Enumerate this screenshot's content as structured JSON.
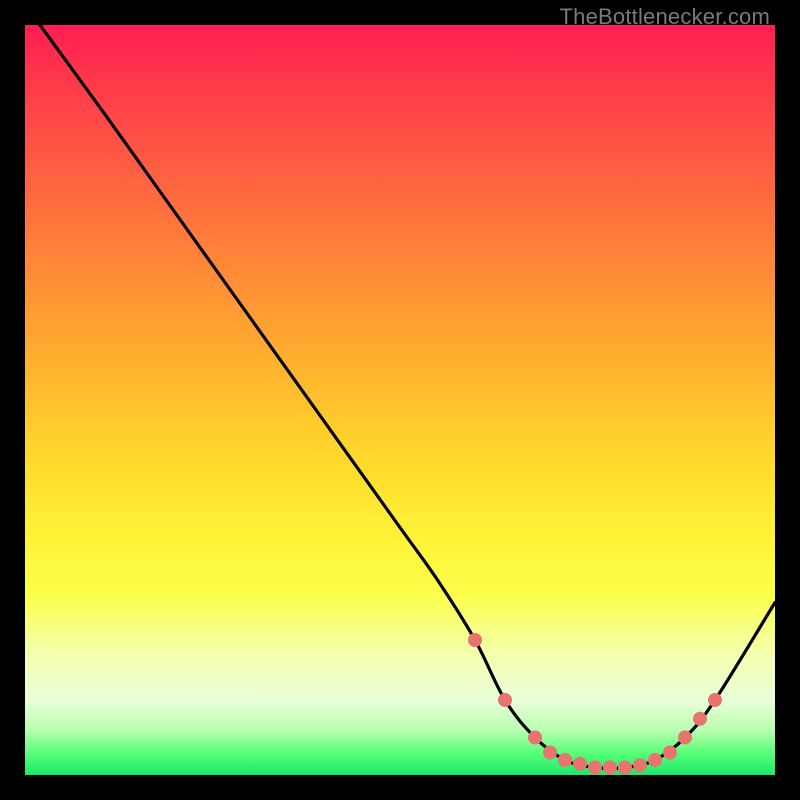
{
  "watermark": "TheBottlenecker.com",
  "chart_data": {
    "type": "line",
    "title": "",
    "xlabel": "",
    "ylabel": "",
    "xlim": [
      0,
      100
    ],
    "ylim": [
      0,
      100
    ],
    "x": [
      2,
      10,
      20,
      30,
      40,
      50,
      55,
      60,
      64,
      68,
      72,
      76,
      80,
      84,
      88,
      92,
      100
    ],
    "values": [
      100,
      89,
      75,
      61,
      47,
      33,
      26,
      18,
      10,
      5,
      2,
      1,
      1,
      2,
      5,
      10,
      23
    ],
    "markers": {
      "x": [
        60,
        64,
        68,
        70,
        72,
        74,
        76,
        78,
        80,
        82,
        84,
        86,
        88,
        90,
        92
      ],
      "values": [
        18,
        10,
        5,
        3,
        2,
        1.5,
        1,
        1,
        1,
        1.3,
        2,
        3,
        5,
        7.5,
        10
      ]
    },
    "gradient_stops": [
      {
        "pos": 0.0,
        "color": "#ff1e52"
      },
      {
        "pos": 0.5,
        "color": "#ffd92c"
      },
      {
        "pos": 0.8,
        "color": "#fcff4a"
      },
      {
        "pos": 0.95,
        "color": "#5aff79"
      },
      {
        "pos": 1.0,
        "color": "#19e86a"
      }
    ]
  }
}
